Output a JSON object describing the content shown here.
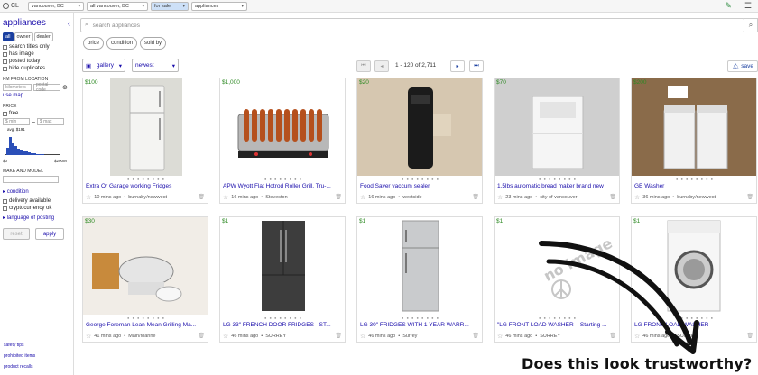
{
  "topbar": {
    "logo": "CL",
    "selects": [
      "vancouver, BC",
      "all vancouver, BC",
      "for sale",
      "appliances"
    ]
  },
  "sidebar": {
    "title": "appliances",
    "segments": [
      "all",
      "owner",
      "dealer"
    ],
    "checks": [
      "search titles only",
      "has image",
      "posted today",
      "hide duplicates"
    ],
    "km_label": "KM FROM LOCATION",
    "km_placeholder": "kilometers",
    "postal_placeholder": "postal code",
    "use_map": "use map...",
    "price_label": "PRICE",
    "free_label": "free",
    "min_placeholder": "$ min",
    "max_placeholder": "$ max",
    "avg": "avg. $191",
    "hist_min": "$0",
    "hist_max": "$200M",
    "histogram": [
      0.35,
      0.85,
      0.55,
      0.4,
      0.3,
      0.25,
      0.2,
      0.15,
      0.12,
      0.1,
      0.08,
      0.06,
      0.05,
      0.04
    ],
    "hist_ticks": [
      "50",
      "$200",
      "$400",
      "$600",
      "$800"
    ],
    "make_label": "MAKE AND MODEL",
    "condition_link": "condition",
    "delivery": "delivery available",
    "crypto": "cryptocurrency ok",
    "language_link": "language of posting",
    "reset": "reset",
    "apply": "apply",
    "footer": [
      "safety tips",
      "prohibited items",
      "product recalls"
    ]
  },
  "search": {
    "placeholder": "search appliances"
  },
  "filters": [
    "price",
    "condition",
    "sold by"
  ],
  "toolbar": {
    "view": "gallery",
    "sort": "newest",
    "range": "1 - 120 of 2,711",
    "save": "save"
  },
  "listings": [
    {
      "price": "$100",
      "title": "Extra Or Garage working Fridges",
      "time": "10 mins ago",
      "location": "burnaby/newwest",
      "image": "white-fridge"
    },
    {
      "price": "$1,000",
      "title": "APW Wyott Flat Hotrod Roller Grill, Tru-...",
      "time": "16 mins ago",
      "location": "Steveston",
      "image": "roller-grill"
    },
    {
      "price": "$20",
      "title": "Food Saver vaccum sealer",
      "time": "16 mins ago",
      "location": "westside",
      "image": "vacuum-sealer"
    },
    {
      "price": "$70",
      "title": "1.5lbs automatic bread maker brand new",
      "time": "23 mins ago",
      "location": "city of vancouver",
      "image": "bread-maker"
    },
    {
      "price": "$200",
      "title": "GE Washer",
      "time": "36 mins ago",
      "location": "burnaby/newwest",
      "image": "ge-washer"
    },
    {
      "price": "$30",
      "title": "George Foreman Lean Mean Grilling Ma...",
      "time": "41 mins ago",
      "location": "Main/Marine",
      "image": "grill"
    },
    {
      "price": "$1",
      "title": "LG 33\" FRENCH DOOR FRIDGES - ST...",
      "time": "46 mins ago",
      "location": "SURREY",
      "image": "french-door-fridge"
    },
    {
      "price": "$1",
      "title": "LG 30\" FRIDGES WITH 1 YEAR WARR...",
      "time": "46 mins ago",
      "location": "Surrey",
      "image": "silver-fridge"
    },
    {
      "price": "$1",
      "title": "\"LG FRONT LOAD WASHER – Starting ...",
      "time": "46 mins ago",
      "location": "SURREY",
      "image": "no-image"
    },
    {
      "price": "$1",
      "title": "LG FRONT LOAD WASHER",
      "time": "46 mins ago",
      "location": "SURREY",
      "image": "front-load-washer"
    }
  ],
  "no_image_text": "no image",
  "overlay": "Does this look trustworthy?",
  "colors": {
    "link": "#1a0dab",
    "price": "#2e8a24",
    "accent": "#1a3fa0"
  }
}
